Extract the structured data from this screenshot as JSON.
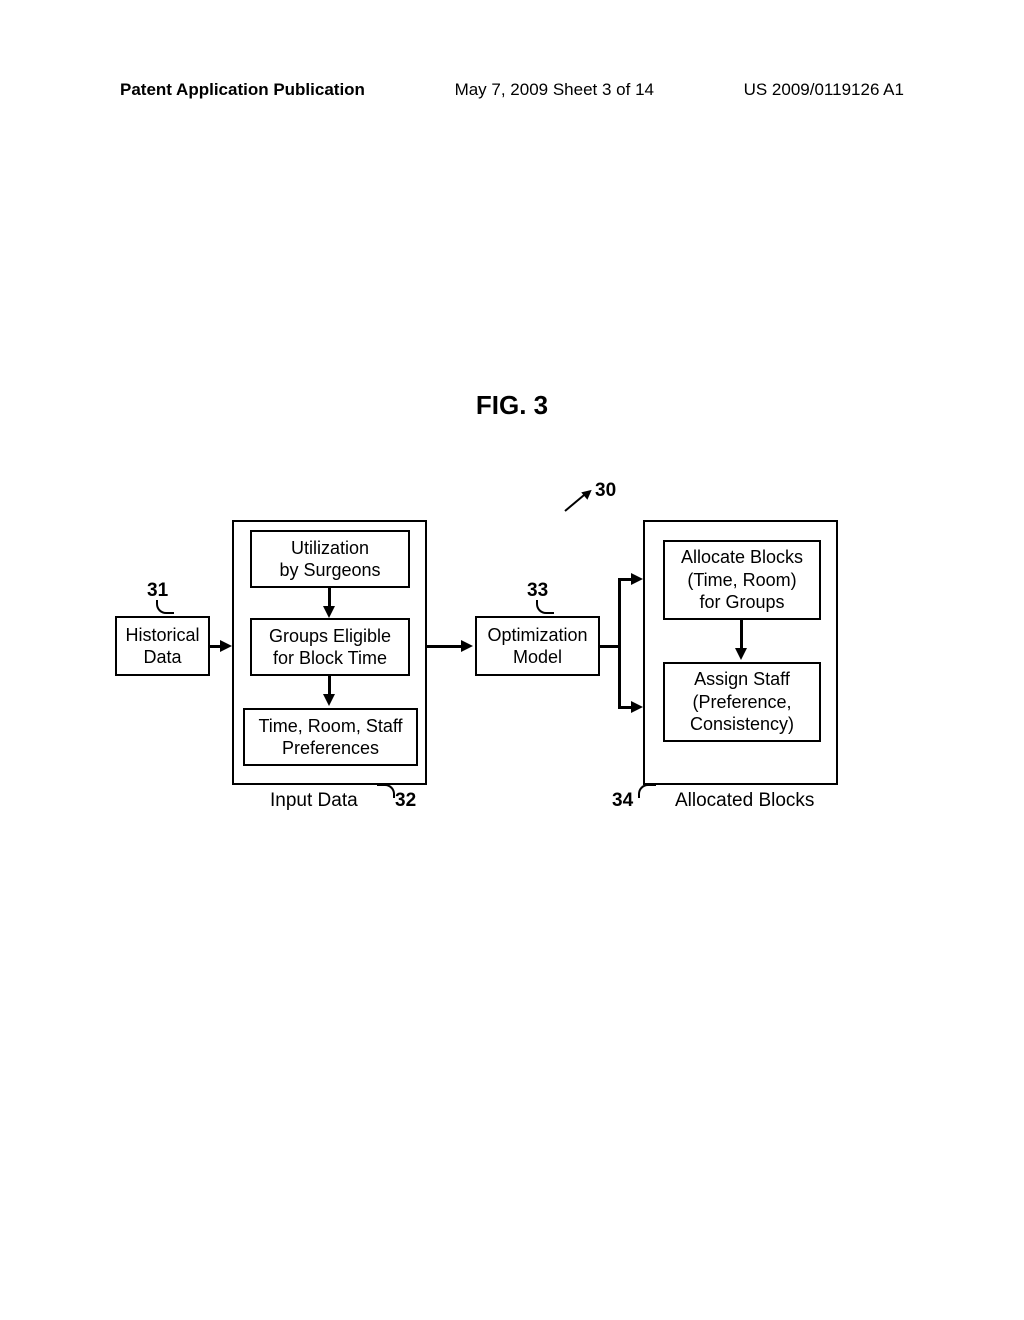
{
  "header": {
    "left": "Patent Application Publication",
    "center": "May 7, 2009  Sheet 3 of 14",
    "right": "US 2009/0119126 A1"
  },
  "figure_title": "FIG. 3",
  "refs": {
    "main": "30",
    "historical": "31",
    "input": "32",
    "optimization": "33",
    "allocated": "34"
  },
  "boxes": {
    "historical_data": "Historical\nData",
    "utilization": "Utilization\nby Surgeons",
    "groups_eligible": "Groups Eligible\nfor Block Time",
    "time_room": "Time, Room, Staff\nPreferences",
    "optimization_model": "Optimization\nModel",
    "allocate_blocks": "Allocate Blocks\n(Time, Room)\nfor Groups",
    "assign_staff": "Assign Staff\n(Preference,\nConsistency)"
  },
  "labels": {
    "input_data": "Input Data",
    "allocated_blocks": "Allocated Blocks"
  }
}
